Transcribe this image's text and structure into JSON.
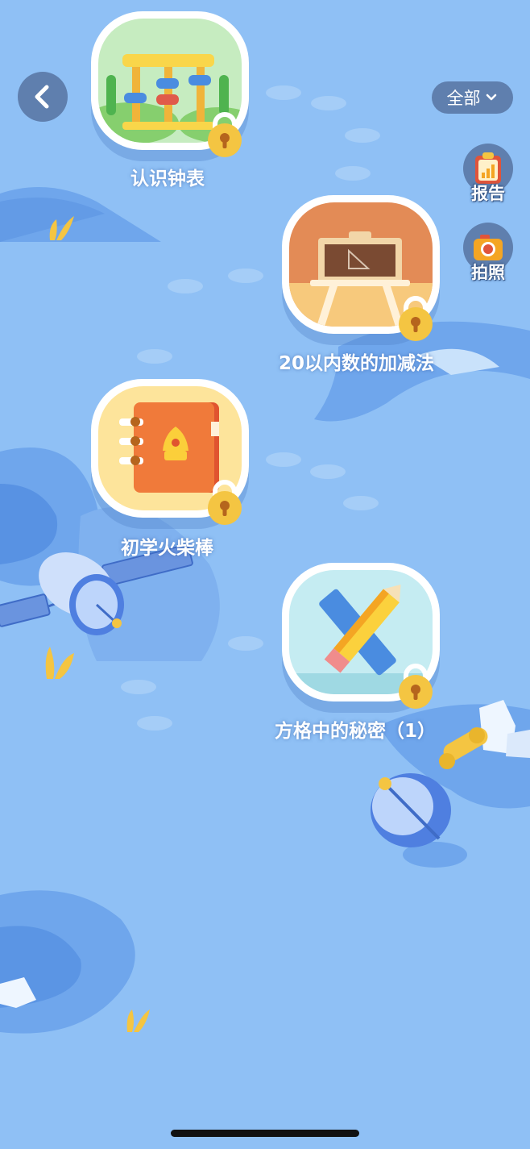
{
  "header": {
    "back_icon": "chevron-left-icon",
    "filter": {
      "label": "全部",
      "icon": "chevron-down-icon"
    }
  },
  "side_actions": [
    {
      "label": "报告",
      "icon": "report-clipboard-icon"
    },
    {
      "label": "拍照",
      "icon": "camera-icon"
    }
  ],
  "lessons": [
    {
      "title": "认识钟表",
      "icon": "abacus-icon",
      "locked": true
    },
    {
      "title": "20以内数的加减法",
      "icon": "blackboard-icon",
      "locked": true
    },
    {
      "title": "初学火柴棒",
      "icon": "notebook-icon",
      "locked": true
    },
    {
      "title": "方格中的秘密（1）",
      "icon": "pencil-ruler-icon",
      "locked": true
    }
  ],
  "colors": {
    "background": "#8fc0f5",
    "button_bg": "#5f7fae",
    "lock": "#f4c542"
  }
}
